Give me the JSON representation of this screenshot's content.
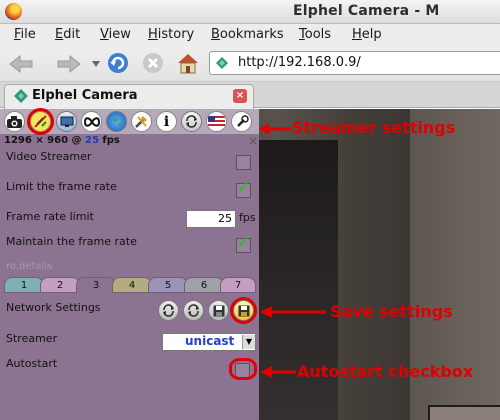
{
  "window": {
    "title": "Elphel Camera - M"
  },
  "menu": [
    "File",
    "Edit",
    "View",
    "History",
    "Bookmarks",
    "Tools",
    "Help"
  ],
  "menu_underline": [
    "F",
    "E",
    "V",
    "H",
    "B",
    "T",
    "H"
  ],
  "menu_rest": [
    "ile",
    "dit",
    "iew",
    "istory",
    "ookmarks",
    "ools",
    "elp"
  ],
  "navbar": {
    "url": "http://192.168.0.9/"
  },
  "tab": {
    "title": "Elphel Camera",
    "close": "×"
  },
  "panel": {
    "resolution": "1296 × 960 @",
    "fps_value": "25",
    "fps_unit": "fps",
    "close_x": "×",
    "video_streamer_label": "Video Streamer",
    "limit_frame_rate_label": "Limit the frame rate",
    "frame_rate_limit_label": "Frame rate limit",
    "frame_rate_limit_value": "25",
    "frame_rate_unit": "fps",
    "maintain_frame_rate_label": "Maintain the frame rate",
    "hidden_row_text": "ro.details",
    "tabs": [
      "1",
      "2",
      "3",
      "4",
      "5",
      "6",
      "7"
    ],
    "network_settings_label": "Network Settings",
    "streamer_label": "Streamer",
    "streamer_value": "unicast",
    "autostart_label": "Autostart",
    "check_mark": "✓"
  },
  "annotations": {
    "streamer_settings": "Streamer settings",
    "save_settings": "Save settings",
    "autostart_checkbox": "Autostart checkbox"
  },
  "colors": {
    "annotation": "#e00000",
    "panel": "#8c7391",
    "check": "#2eb82e",
    "fps": "#1f3fb0"
  }
}
